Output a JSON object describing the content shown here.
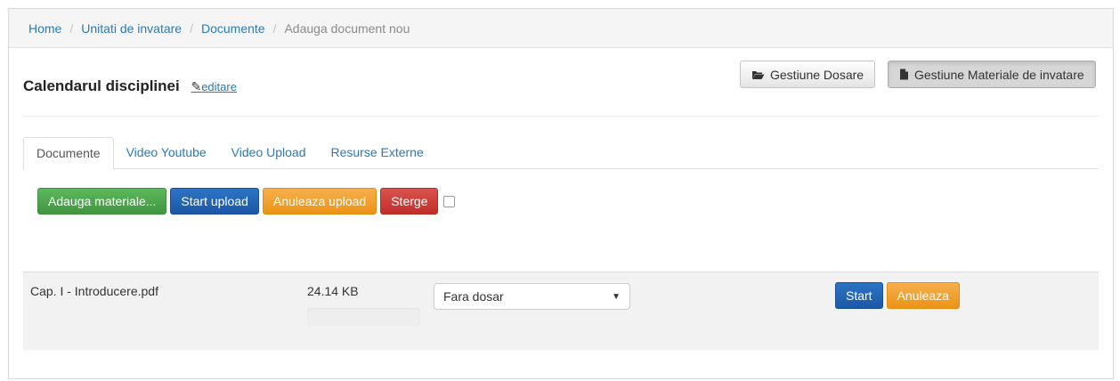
{
  "breadcrumb": {
    "items": [
      "Home",
      "Unitati de invatare",
      "Documente"
    ],
    "separator": "/",
    "current": "Adauga document nou"
  },
  "header": {
    "title": "Calendarul disciplinei",
    "edit_icon": "pencil-square-icon",
    "edit_label": "editare",
    "buttons": {
      "dosare": {
        "icon": "folder-open-icon",
        "label": "Gestiune Dosare"
      },
      "materiale": {
        "icon": "file-icon",
        "label": "Gestiune Materiale de invatare",
        "active": true
      }
    }
  },
  "tabs": [
    {
      "label": "Documente",
      "active": true
    },
    {
      "label": "Video Youtube"
    },
    {
      "label": "Video Upload"
    },
    {
      "label": "Resurse Externe"
    }
  ],
  "actions": {
    "add": "Adauga materiale...",
    "start": "Start upload",
    "cancel": "Anuleaza upload",
    "delete": "Sterge",
    "select_all_checked": false
  },
  "files": [
    {
      "name": "Cap. I - Introducere.pdf",
      "size": "24.14 KB",
      "progress": 0,
      "folder": "Fara dosar",
      "start_label": "Start",
      "cancel_label": "Anuleaza"
    }
  ],
  "colors": {
    "link": "#2a7ab8",
    "success": "#5cb85c",
    "primary": "#1c58a6",
    "warning": "#f0a030",
    "danger": "#d9534f"
  }
}
